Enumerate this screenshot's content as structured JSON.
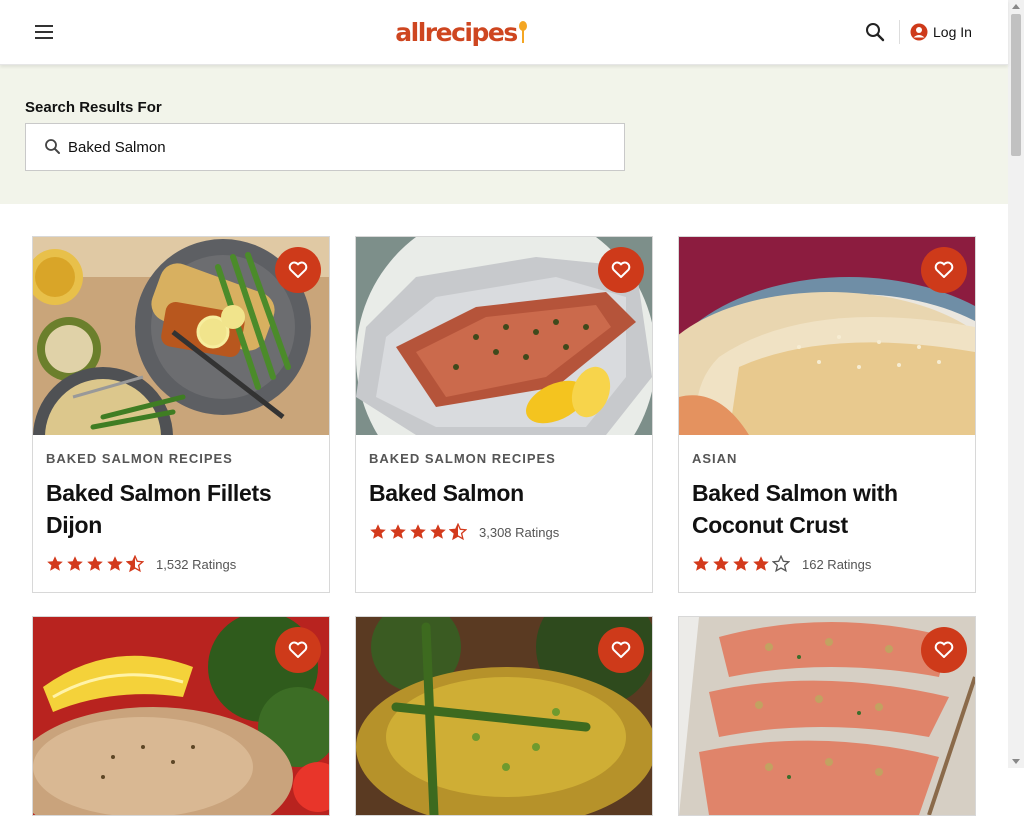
{
  "header": {
    "logo_text": "allrecipes",
    "login_label": "Log In",
    "icons": {
      "menu": "hamburger-menu-icon",
      "search": "search-icon",
      "user": "user-icon"
    }
  },
  "search": {
    "title": "Search Results For",
    "query": "Baked Salmon",
    "icon": "search-icon"
  },
  "colors": {
    "brand": "#ce4620",
    "star": "#d33a1c",
    "band": "#f2f4ea",
    "fav": "#ce3a1a"
  },
  "cards": [
    {
      "category": "BAKED SALMON RECIPES",
      "title": "Baked Salmon Fillets Dijon",
      "rating": 4.5,
      "ratings_label": "1,532 Ratings"
    },
    {
      "category": "BAKED SALMON RECIPES",
      "title": "Baked Salmon",
      "rating": 4.5,
      "ratings_label": "3,308 Ratings"
    },
    {
      "category": "ASIAN",
      "title": "Baked Salmon with Coconut Crust",
      "rating": 4,
      "ratings_label": "162 Ratings"
    },
    {
      "category": "",
      "title": "",
      "rating": null,
      "ratings_label": ""
    },
    {
      "category": "",
      "title": "",
      "rating": null,
      "ratings_label": ""
    },
    {
      "category": "",
      "title": "",
      "rating": null,
      "ratings_label": ""
    }
  ]
}
